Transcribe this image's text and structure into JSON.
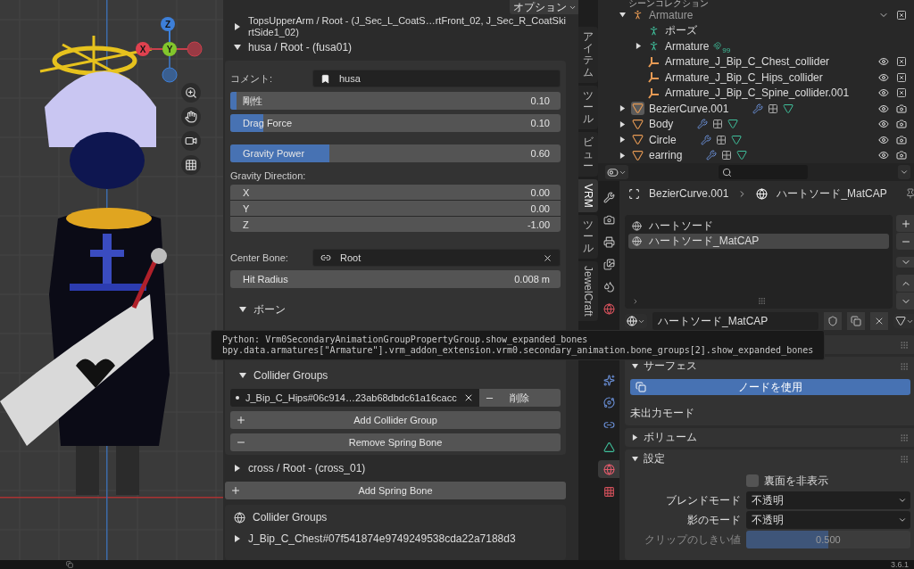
{
  "viewport": {
    "gizmo": [
      {
        "label": "Z",
        "color": "#3d7fd8"
      },
      {
        "label": "X",
        "color": "#e0414f"
      },
      {
        "label": "Y",
        "color": "#82c62c"
      }
    ]
  },
  "sidebar": {
    "options_button": "オプション",
    "groups": [
      {
        "title": "TopsUpperArm / Root - (J_Sec_L_CoatS…rtFront_02, J_Sec_R_CoatSkirtSide1_02)",
        "expanded": false
      },
      {
        "title": "husa / Root - (fusa01)",
        "expanded": true
      },
      {
        "title": "cross / Root - (cross_01)",
        "expanded": false
      }
    ],
    "detail": {
      "comment": {
        "label": "コメント:",
        "value": "husa"
      },
      "sliders": [
        {
          "label": "剛性",
          "reading": "0.10",
          "level": 0.02
        },
        {
          "label": "Drag Force",
          "reading": "0.10",
          "level": 0.1
        },
        {
          "label": "Gravity Power",
          "reading": "0.60",
          "level": 0.3
        }
      ],
      "gravity_direction": {
        "label": "Gravity Direction:",
        "components": [
          {
            "axis": "X",
            "value": "0.00"
          },
          {
            "axis": "Y",
            "value": "0.00"
          },
          {
            "axis": "Z",
            "value": "-1.00"
          }
        ]
      },
      "center_bone": {
        "label": "Center Bone:",
        "value": "Root"
      },
      "hit_radius": {
        "label": "Hit Radius",
        "value": "0.008 m"
      },
      "bones": {
        "title": "ボーン",
        "expanded": true
      },
      "collider_groups": {
        "title": "Collider Groups",
        "expanded": true,
        "items": [
          {
            "value": "J_Bip_C_Hips#06c914…23ab68dbdc61a16cacc",
            "remove": "削除"
          }
        ],
        "add_button": "Add Collider Group"
      },
      "remove_button": "Remove Spring Bone"
    },
    "add_spring_bone": "Add Spring Bone",
    "collider_panel": {
      "title": "Collider Groups",
      "items": [
        {
          "label": "J_Bip_C_Chest#07f541874e9749249538cda22a7188d3",
          "expanded": false
        }
      ]
    },
    "tabs": [
      {
        "label": "アイテム",
        "kind": "stacked",
        "selected": false
      },
      {
        "label": "ツール",
        "kind": "stacked",
        "selected": false
      },
      {
        "label": "ビュー",
        "kind": "stacked",
        "selected": false
      },
      {
        "label": "VRM",
        "kind": "rotated",
        "selected": true
      },
      {
        "label": "ツール",
        "kind": "stacked",
        "selected": false
      },
      {
        "label": "JewelCraft",
        "kind": "rotated",
        "selected": false
      }
    ]
  },
  "tooltip": {
    "lines": [
      "Python: Vrm0SecondaryAnimationGroupPropertyGroup.show_expanded_bones",
      "bpy.data.armatures[\"Armature\"].vrm_addon_extension.vrm0.secondary_animation.bone_groups[2].show_expanded_bones"
    ]
  },
  "outliner": {
    "header": "シーンコレクション",
    "rows": [
      {
        "name": "Armature",
        "kind": "armature",
        "expanded": true,
        "selected": false,
        "children": [
          {
            "name": "ポーズ",
            "kind": "pose",
            "selected": false
          },
          {
            "name": "Armature",
            "kind": "armature_data",
            "expanded": false,
            "badge": "99",
            "selected": false
          },
          {
            "name": "Armature_J_Bip_C_Chest_collider",
            "kind": "empty",
            "selected": false
          },
          {
            "name": "Armature_J_Bip_C_Hips_collider",
            "kind": "empty",
            "selected": false
          },
          {
            "name": "Armature_J_Bip_C_Spine_collider.001",
            "kind": "empty",
            "selected": false
          }
        ]
      },
      {
        "name": "BezierCurve.001",
        "kind": "mesh",
        "expanded": false,
        "selected": true
      },
      {
        "name": "Body",
        "kind": "mesh",
        "expanded": false,
        "selected": false
      },
      {
        "name": "Circle",
        "kind": "mesh",
        "expanded": false,
        "selected": false
      },
      {
        "name": "earring",
        "kind": "mesh",
        "expanded": false,
        "selected": false
      }
    ]
  },
  "properties": {
    "tabs": [
      {
        "kind": "tool",
        "selected": false
      },
      {
        "kind": "render",
        "selected": false
      },
      {
        "kind": "output",
        "selected": false
      },
      {
        "kind": "view_layer",
        "selected": false
      },
      {
        "kind": "scene",
        "selected": false
      },
      {
        "kind": "world",
        "selected": false
      },
      {
        "kind": "particles",
        "selected": false
      },
      {
        "kind": "physics",
        "selected": false
      },
      {
        "kind": "constraints",
        "selected": false
      },
      {
        "kind": "data",
        "selected": false
      },
      {
        "kind": "material",
        "selected": true
      },
      {
        "kind": "texture",
        "selected": false
      }
    ],
    "breadcrumb": {
      "object": "BezierCurve.001",
      "material": "ハートソード_MatCAP"
    },
    "material_slots": [
      {
        "name": "ハートソード",
        "selected": false
      },
      {
        "name": "ハートソード_MatCAP",
        "selected": true
      }
    ],
    "material_name": "ハートソード_MatCAP",
    "surface": {
      "title": "サーフェス",
      "expanded": true,
      "use_nodes": "ノードを使用",
      "note": "未出力モード"
    },
    "volume": {
      "title": "ボリューム",
      "expanded": false
    },
    "settings": {
      "title": "設定",
      "expanded": true,
      "backface": {
        "label": "裏面を非表示",
        "checked": false
      },
      "selects": [
        {
          "label": "ブレンドモード",
          "value": "不透明"
        },
        {
          "label": "影のモード",
          "value": "不透明"
        }
      ],
      "clip": {
        "label": "クリップのしきい値",
        "reading": "0.500",
        "level": 0.5,
        "disabled": true
      }
    }
  },
  "status_bar": {
    "version": "3.6.1"
  }
}
